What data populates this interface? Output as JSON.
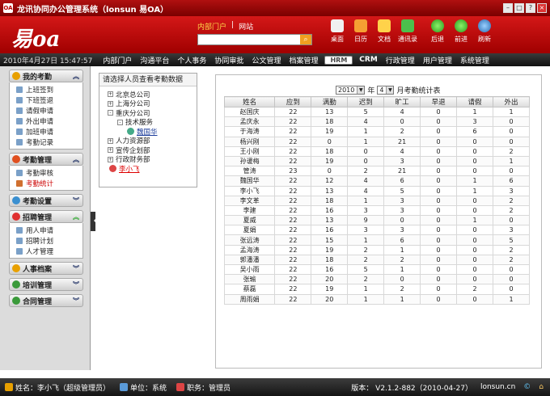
{
  "titlebar": {
    "app_icon": "OA",
    "title": "龙讯协同办公管理系统（lonsun 易OA）",
    "buttons": [
      "minimize",
      "restore",
      "help",
      "close"
    ]
  },
  "header": {
    "logo_text": "易oa",
    "portal_link": "内部门户",
    "site_link": "网站",
    "search_placeholder": "",
    "tools": [
      {
        "label": "桌面",
        "icon": "home-icon",
        "color": "#f0f0f0"
      },
      {
        "label": "日历",
        "icon": "calendar-icon",
        "color": "#f5a033"
      },
      {
        "label": "文档",
        "icon": "document-icon",
        "color": "#ffd24a"
      },
      {
        "label": "通讯录",
        "icon": "addressbook-icon",
        "color": "#4cc04c"
      }
    ],
    "nav_tools": [
      {
        "label": "后退",
        "icon": "back-icon"
      },
      {
        "label": "前进",
        "icon": "forward-icon"
      },
      {
        "label": "刷新",
        "icon": "refresh-icon"
      }
    ]
  },
  "navbar": {
    "date": "2010年4月27日 15:47:57",
    "items": [
      "内部门户",
      "沟通平台",
      "个人事务",
      "协同审批",
      "公文管理",
      "档案管理",
      "HRM",
      "CRM",
      "行政管理",
      "用户管理",
      "系统管理"
    ],
    "selected_index": 6
  },
  "sidebar": {
    "groups": [
      {
        "title": "我的考勤",
        "icon_color": "#e8a000",
        "expanded": true,
        "items": [
          "上班签到",
          "下班签退",
          "请假申请",
          "外出申请",
          "加班申请",
          "考勤记录"
        ]
      },
      {
        "title": "考勤管理",
        "icon_color": "#e05020",
        "expanded": true,
        "items": [
          "考勤审核",
          "考勤统计"
        ],
        "active_item": 1
      },
      {
        "title": "考勤设置",
        "icon_color": "#3a8fd0",
        "expanded": false,
        "items": []
      },
      {
        "title": "招聘管理",
        "icon_color": "#e03030",
        "expanded": true,
        "items": [
          "用人申请",
          "招聘计划",
          "人才管理"
        ]
      },
      {
        "title": "人事档案",
        "icon_color": "#e8a000",
        "expanded": false,
        "items": []
      },
      {
        "title": "培训管理",
        "icon_color": "#3a9a3a",
        "expanded": false,
        "items": []
      },
      {
        "title": "合同管理",
        "icon_color": "#3a9a3a",
        "expanded": false,
        "items": []
      }
    ]
  },
  "tree": {
    "header": "请选择人员查看考勤数据",
    "nodes": [
      {
        "label": "北京总公司",
        "level": 1,
        "toggle": "+"
      },
      {
        "label": "上海分公司",
        "level": 1,
        "toggle": "+"
      },
      {
        "label": "重庆分公司",
        "level": 1,
        "toggle": "-"
      },
      {
        "label": "技术服务",
        "level": 2,
        "toggle": "-"
      },
      {
        "label": "魏国华",
        "level": 3,
        "toggle": "",
        "user": true
      },
      {
        "label": "人力资源部",
        "level": 1,
        "toggle": "+"
      },
      {
        "label": "宣传企划部",
        "level": 1,
        "toggle": "+"
      },
      {
        "label": "行政财务部",
        "level": 1,
        "toggle": "+"
      },
      {
        "label": "李小飞",
        "level": 1,
        "toggle": "",
        "user": true,
        "current": true
      }
    ]
  },
  "stats": {
    "year": "2010",
    "year_suffix": "年",
    "month": "4",
    "month_suffix": "月考勤统计表",
    "columns": [
      "姓名",
      "应到",
      "满勤",
      "迟到",
      "旷工",
      "早退",
      "请假",
      "外出"
    ],
    "rows": [
      [
        "赵国庆",
        "22",
        "13",
        "5",
        "4",
        "0",
        "1",
        "1"
      ],
      [
        "孟庆永",
        "22",
        "18",
        "4",
        "0",
        "0",
        "3",
        "0"
      ],
      [
        "于海涛",
        "22",
        "19",
        "1",
        "2",
        "0",
        "6",
        "0"
      ],
      [
        "杨兴刚",
        "22",
        "0",
        "1",
        "21",
        "0",
        "0",
        "0"
      ],
      [
        "王小刚",
        "22",
        "18",
        "0",
        "4",
        "0",
        "0",
        "2"
      ],
      [
        "孙谖梅",
        "22",
        "19",
        "0",
        "3",
        "0",
        "0",
        "1"
      ],
      [
        "管涛",
        "23",
        "0",
        "2",
        "21",
        "0",
        "0",
        "0"
      ],
      [
        "魏国华",
        "22",
        "12",
        "4",
        "6",
        "0",
        "1",
        "6"
      ],
      [
        "李小飞",
        "22",
        "13",
        "4",
        "5",
        "0",
        "1",
        "3"
      ],
      [
        "李文革",
        "22",
        "18",
        "1",
        "3",
        "0",
        "0",
        "2"
      ],
      [
        "李建",
        "22",
        "16",
        "3",
        "3",
        "0",
        "0",
        "2"
      ],
      [
        "夏威",
        "22",
        "13",
        "9",
        "0",
        "0",
        "1",
        "0"
      ],
      [
        "夏娟",
        "22",
        "16",
        "3",
        "3",
        "0",
        "0",
        "3"
      ],
      [
        "张远涛",
        "22",
        "15",
        "1",
        "6",
        "0",
        "0",
        "5"
      ],
      [
        "孟海涛",
        "22",
        "19",
        "2",
        "1",
        "0",
        "0",
        "2"
      ],
      [
        "郭潘潘",
        "22",
        "18",
        "2",
        "2",
        "0",
        "0",
        "2"
      ],
      [
        "吴小雨",
        "22",
        "16",
        "5",
        "1",
        "0",
        "0",
        "0"
      ],
      [
        "张瑜",
        "22",
        "20",
        "2",
        "0",
        "0",
        "0",
        "0"
      ],
      [
        "蔡磊",
        "22",
        "19",
        "1",
        "2",
        "0",
        "2",
        "0"
      ],
      [
        "周雨娟",
        "22",
        "20",
        "1",
        "1",
        "0",
        "0",
        "1"
      ]
    ]
  },
  "statusbar": {
    "name_label": "姓名：李小飞（超级管理员）",
    "unit_label": "单位：系统",
    "job_label": "职务：管理员",
    "version": "版本： V2.1.2-882（2010-04-27）",
    "site": "lonsun.cn"
  }
}
